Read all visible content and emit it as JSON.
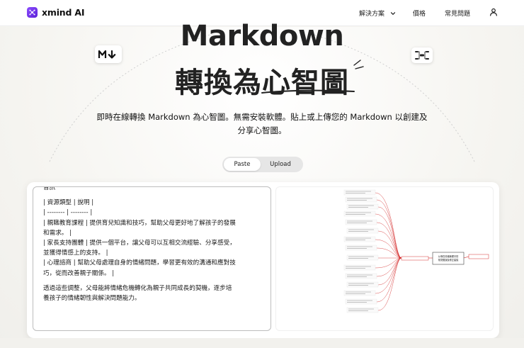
{
  "brand": {
    "name": "xmind AI",
    "accent": "#6a2ee8"
  },
  "nav": {
    "solutions": "解決方案",
    "pricing": "價格",
    "faq": "常見問題",
    "user_icon": "user-icon"
  },
  "hero": {
    "title_line1": "Markdown",
    "title_line2": "轉換為心智圖",
    "subtitle_line1": "即時在線轉換 Markdown 為心智圖。無需安裝軟體。貼上或上傳您的 Markdown 以創建及",
    "subtitle_line2": "分享心智圖。",
    "md_badge_icon": "markdown-icon",
    "mm_badge_icon": "mindmap-icon"
  },
  "mode_switch": {
    "paste": "Paste",
    "upload": "Upload",
    "selected": "Paste"
  },
  "editor": {
    "lines": [
      "音訊",
      "",
      "| 資源類型 | 說明 |",
      "| -------- | -------- |",
      "| 親職教育課程 | 提供育兒知識和技巧，幫助父母更好地了解孩子的發展",
      "和需求。 |",
      "| 家長支持團體 | 提供一個平台，讓父母可以互相交流經驗、分享感受，",
      "並獲得情感上的支持。 |",
      "| 心理諮商 | 幫助父母處理自身的情緒問題，學習更有效的溝通和應對技",
      "巧，從而改善親子關係。 |",
      "",
      "透過這些調整，父母能將情緒危機轉化為親子共同成長的契機，逐步培",
      "養孩子的情緒韌性與解決問題能力。"
    ]
  },
  "preview": {
    "central_topic": "父母在情緒管理中的常見錯誤及修正建議"
  }
}
